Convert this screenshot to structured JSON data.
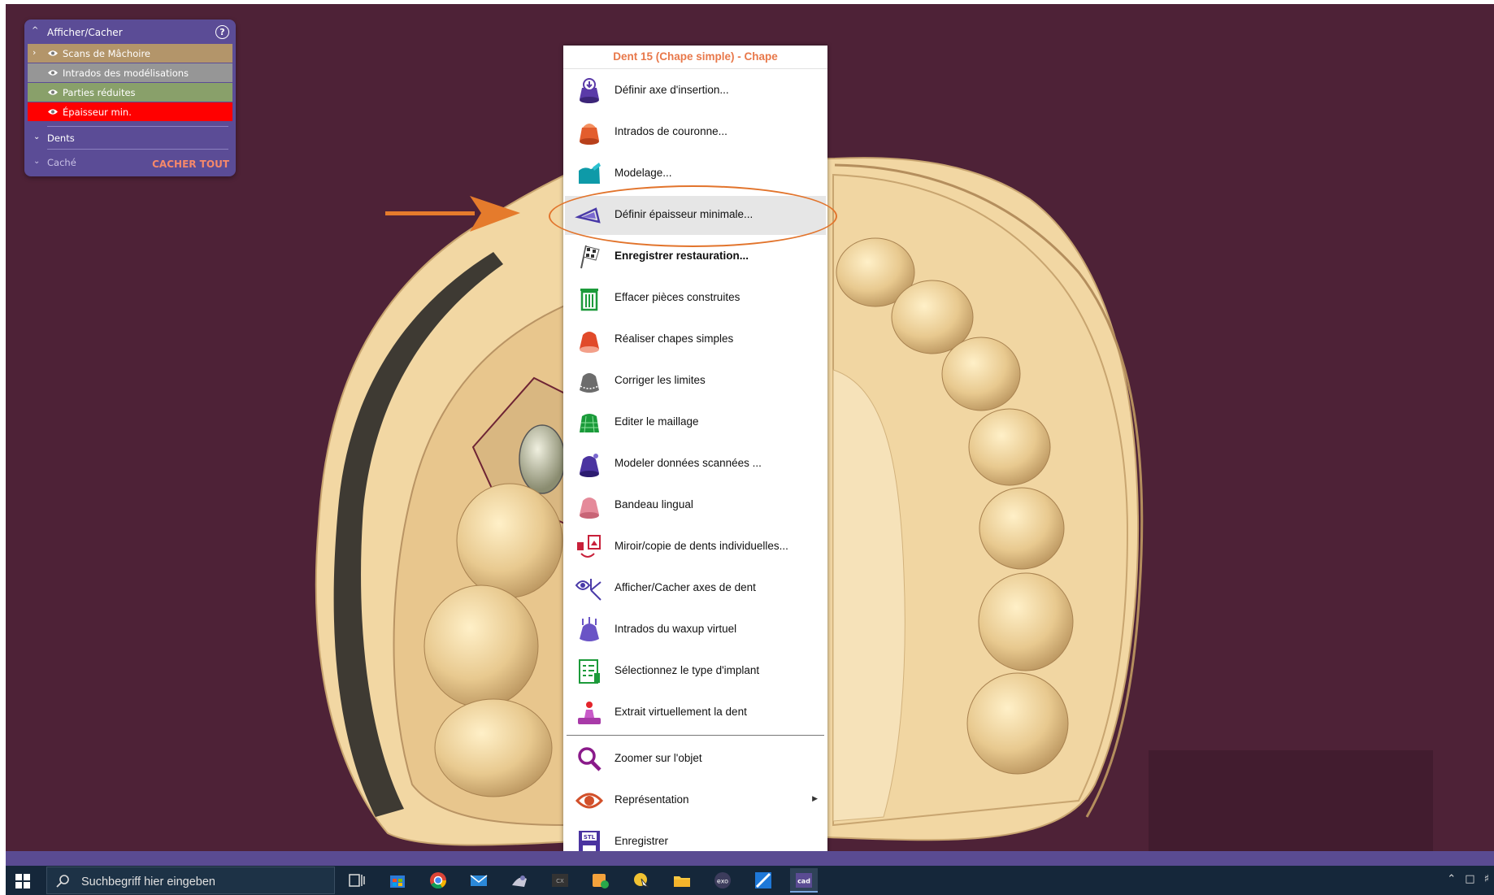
{
  "visibility_panel": {
    "title": "Afficher/Cacher",
    "layers": [
      {
        "label": "Scans de Mâchoire",
        "color": "#b3956a"
      },
      {
        "label": "Intrados des modélisations",
        "color": "#969696"
      },
      {
        "label": "Parties réduites",
        "color": "#89a06a"
      },
      {
        "label": "Épaisseur min.",
        "color": "#ff0000"
      }
    ],
    "dents": "Dents",
    "cache": "Caché",
    "hide_all": "CACHER TOUT"
  },
  "context_menu": {
    "title": "Dent 15 (Chape simple) - Chape",
    "items": [
      {
        "label": "Définir axe d'insertion...",
        "icon": "insertion-axis-icon"
      },
      {
        "label": "Intrados de couronne...",
        "icon": "crown-intrados-icon"
      },
      {
        "label": "Modelage...",
        "icon": "modeling-icon"
      },
      {
        "label": "Définir épaisseur minimale...",
        "icon": "min-thickness-icon"
      },
      {
        "label": "Enregistrer restauration...",
        "icon": "checkered-flag-icon"
      },
      {
        "label": "Effacer pièces construites",
        "icon": "trash-icon"
      },
      {
        "label": "Réaliser chapes simples",
        "icon": "simple-coping-icon"
      },
      {
        "label": "Corriger les limites",
        "icon": "margin-line-icon"
      },
      {
        "label": "Editer le maillage",
        "icon": "mesh-edit-icon"
      },
      {
        "label": "Modeler données scannées ...",
        "icon": "scan-data-icon"
      },
      {
        "label": "Bandeau lingual",
        "icon": "lingual-band-icon"
      },
      {
        "label": "Miroir/copie de dents individuelles...",
        "icon": "mirror-copy-icon"
      },
      {
        "label": "Afficher/Cacher axes de dent",
        "icon": "tooth-axes-icon"
      },
      {
        "label": "Intrados du waxup virtuel",
        "icon": "waxup-intrados-icon"
      },
      {
        "label": "Sélectionnez le type d'implant",
        "icon": "implant-list-icon"
      },
      {
        "label": "Extrait virtuellement la dent",
        "icon": "extract-tooth-icon"
      },
      {
        "label": "Zoomer sur l'objet",
        "icon": "magnifier-icon"
      },
      {
        "label": "Représentation",
        "icon": "eye-icon"
      },
      {
        "label": "Enregistrer",
        "icon": "save-stl-icon"
      }
    ],
    "highlighted_index": 3,
    "ring_color": "#e2742c"
  },
  "taskbar": {
    "search_placeholder": "Suchbegriff hier eingeben",
    "stl_label": "STL",
    "exo_label": "exo",
    "cad_label": "cad"
  },
  "colors": {
    "viewport_bg": "#4e2237",
    "model": "#f1d6a2",
    "panel": "#5b4c96",
    "menu_title": "#e8784a"
  }
}
